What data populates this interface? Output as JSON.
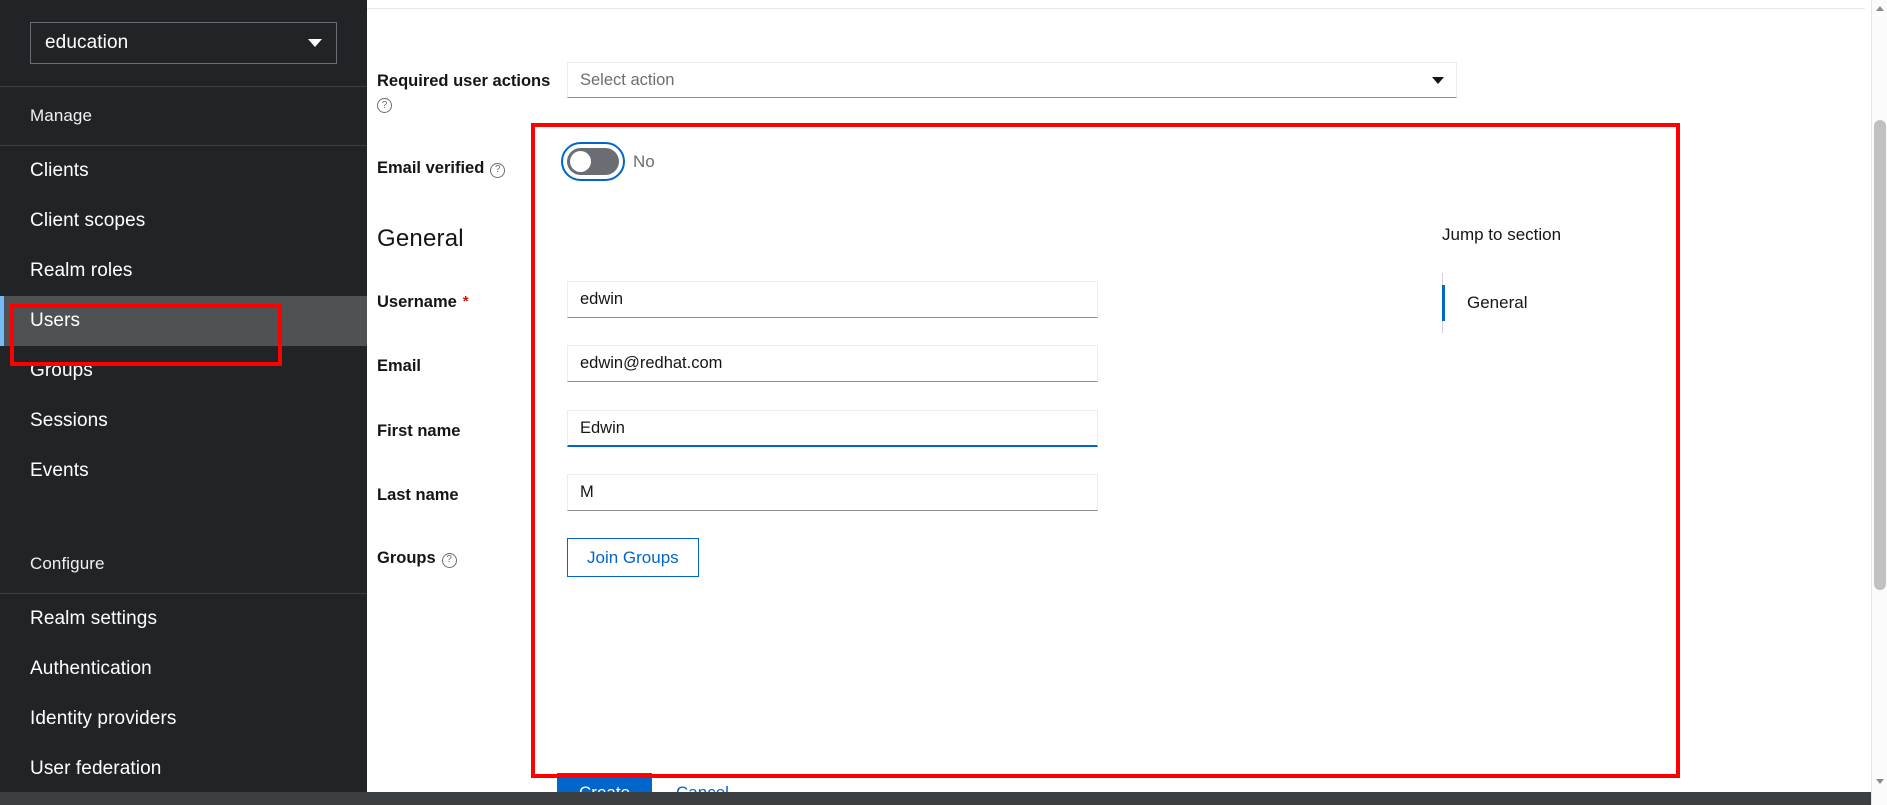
{
  "sidebar": {
    "realm_select": {
      "value": "education",
      "icon": "chevron-down-icon"
    },
    "groups": [
      {
        "heading": "Manage",
        "items": [
          {
            "label": "Clients",
            "active": false
          },
          {
            "label": "Client scopes",
            "active": false
          },
          {
            "label": "Realm roles",
            "active": false
          },
          {
            "label": "Users",
            "active": true
          },
          {
            "label": "Groups",
            "active": false
          },
          {
            "label": "Sessions",
            "active": false
          },
          {
            "label": "Events",
            "active": false
          }
        ]
      },
      {
        "heading": "Configure",
        "items": [
          {
            "label": "Realm settings",
            "active": false
          },
          {
            "label": "Authentication",
            "active": false
          },
          {
            "label": "Identity providers",
            "active": false
          },
          {
            "label": "User federation",
            "active": false
          }
        ]
      }
    ]
  },
  "form": {
    "required_user_actions": {
      "label": "Required user actions",
      "placeholder": "Select action",
      "value": "",
      "help_icon": "help-circle-icon",
      "caret_icon": "chevron-down-icon"
    },
    "email_verified": {
      "label": "Email verified",
      "help_icon": "help-circle-icon",
      "state_label": "No",
      "checked": false
    },
    "section_general": "General",
    "username": {
      "label": "Username",
      "required_marker": "*",
      "value": "edwin",
      "placeholder": ""
    },
    "email": {
      "label": "Email",
      "value": "edwin@redhat.com",
      "placeholder": ""
    },
    "first_name": {
      "label": "First name",
      "value": "Edwin",
      "placeholder": "",
      "focused": true
    },
    "last_name": {
      "label": "Last name",
      "value": "M",
      "placeholder": ""
    },
    "groups": {
      "label": "Groups",
      "help_icon": "help-circle-icon",
      "button_label": "Join Groups"
    },
    "actions": {
      "create_label": "Create",
      "cancel_label": "Cancel"
    }
  },
  "jump_to_section": {
    "title": "Jump to section",
    "items": [
      {
        "label": "General",
        "active": true
      }
    ]
  },
  "colors": {
    "accent_blue": "#06c",
    "sidebar_bg": "#212427",
    "sidebar_active_bg": "#4f5255",
    "active_marker": "#73bcf7",
    "required_red": "#c9190b",
    "annotation_red": "#ff0000"
  }
}
